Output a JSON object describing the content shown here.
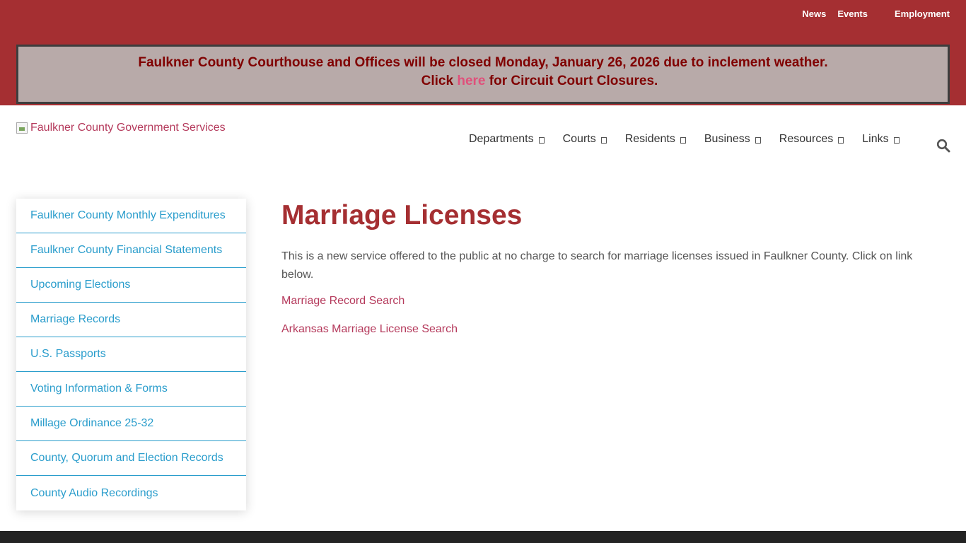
{
  "utility_nav": {
    "news": "News",
    "events": "Events",
    "employment": "Employment"
  },
  "alert": {
    "line1": "Faulkner County Courthouse and Offices will be closed Monday, January 26, 2026 due to inclement weather.",
    "line2_before": "Click ",
    "line2_link": "here",
    "line2_after": " for Circuit Court Closures."
  },
  "logo": {
    "alt_text": "Faulkner County Government Services"
  },
  "main_nav": {
    "items": [
      {
        "label": "Departments"
      },
      {
        "label": "Courts"
      },
      {
        "label": "Residents"
      },
      {
        "label": "Business"
      },
      {
        "label": "Resources"
      },
      {
        "label": "Links"
      }
    ],
    "search_icon": "search-icon"
  },
  "sidebar": {
    "items": [
      {
        "label": "Faulkner County Monthly Expenditures"
      },
      {
        "label": "Faulkner County Financial Statements"
      },
      {
        "label": "Upcoming Elections"
      },
      {
        "label": "Marriage Records"
      },
      {
        "label": "U.S. Passports"
      },
      {
        "label": "Voting Information & Forms"
      },
      {
        "label": "Millage Ordinance 25-32"
      },
      {
        "label": "County, Quorum and Election Records"
      },
      {
        "label": "County Audio Recordings"
      }
    ]
  },
  "content": {
    "title": "Marriage Licenses",
    "intro": "This is a new service offered to the public at no charge to search for marriage licenses issued in Faulkner County. Click on link below.",
    "links": [
      {
        "label": "Marriage Record Search"
      },
      {
        "label": "Arkansas Marriage License Search"
      }
    ]
  },
  "colors": {
    "brand_red": "#a52f32",
    "alert_bg": "#b8aaa9",
    "alert_text": "#800000",
    "link_pink": "#b53a5c",
    "sidebar_blue": "#2a9dcc",
    "footer_dark": "#232323"
  }
}
